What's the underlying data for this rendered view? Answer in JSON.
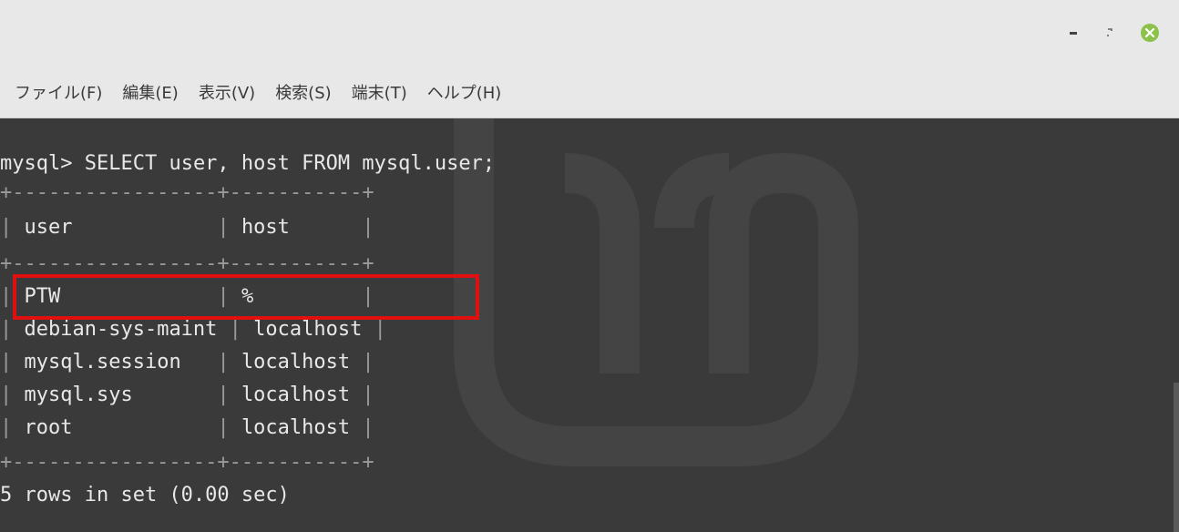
{
  "window": {
    "controls": {
      "minimize": "–",
      "maximize": "▫",
      "close": "×"
    }
  },
  "menu": {
    "items": [
      "ファイル(F)",
      "編集(E)",
      "表示(V)",
      "検索(S)",
      "端末(T)",
      "ヘルプ(H)"
    ]
  },
  "terminal": {
    "prompt": "mysql>",
    "command": "SELECT user, host FROM mysql.user;",
    "table": {
      "border_top": "+-----------------+-----------+",
      "border_mid": "+-----------------+-----------+",
      "border_bottom": "+-----------------+-----------+",
      "headers": [
        "user",
        "host"
      ],
      "rows": [
        [
          "PTW",
          "%"
        ],
        [
          "debian-sys-maint",
          "localhost"
        ],
        [
          "mysql.session",
          "localhost"
        ],
        [
          "mysql.sys",
          "localhost"
        ],
        [
          "root",
          "localhost"
        ]
      ]
    },
    "result": "5 rows in set (0.00 sec)"
  },
  "colors": {
    "terminal_bg": "#3a3a3a",
    "highlight": "#e01010",
    "close_button": "#7bbf3a"
  },
  "icons": {
    "watermark": "linux-mint-logo-icon"
  }
}
